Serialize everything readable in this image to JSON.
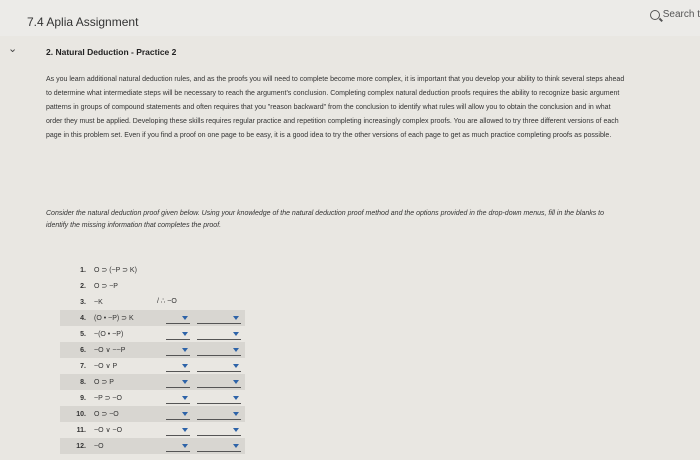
{
  "header": {
    "title": "7.4 Aplia Assignment",
    "search_label": "Search t"
  },
  "nav": {
    "back_symbol": "⌄"
  },
  "page": {
    "heading": "2. Natural Deduction - Practice 2",
    "intro": "As you learn additional natural deduction rules, and as the proofs you will need to complete become more complex, it is important that you develop your ability to think several steps ahead to determine what intermediate steps will be necessary to reach the argument's conclusion. Completing complex natural deduction proofs requires the ability to recognize basic argument patterns in groups of compound statements and often requires that you \"reason backward\" from the conclusion to identify what rules will allow you to obtain the conclusion and in what order they must be applied. Developing these skills requires regular practice and repetition completing increasingly complex proofs. You are allowed to try three different versions of each page in this problem set. Even if you find a proof on one page to be easy, it is a good idea to try the other versions of each page to get as much practice completing proofs as possible.",
    "instructions": "Consider the natural deduction proof given below. Using your knowledge of the natural deduction proof method and the options provided in the drop-down menus, fill in the blanks to identify the missing information that completes the proof."
  },
  "proof": {
    "conclusion_marker": "/ ∴ ~O",
    "rows": [
      {
        "num": "1.",
        "formula": "O ⊃ (~P ⊃ K)"
      },
      {
        "num": "2.",
        "formula": "O ⊃ ~P"
      },
      {
        "num": "3.",
        "formula": "~K"
      },
      {
        "num": "4.",
        "formula": "(O • ~P) ⊃ K"
      },
      {
        "num": "5.",
        "formula": "~(O • ~P)"
      },
      {
        "num": "6.",
        "formula": "~O ∨ ~~P"
      },
      {
        "num": "7.",
        "formula": "~O ∨ P"
      },
      {
        "num": "8.",
        "formula": "O ⊃ P"
      },
      {
        "num": "9.",
        "formula": "~P ⊃ ~O"
      },
      {
        "num": "10.",
        "formula": "O ⊃ ~O"
      },
      {
        "num": "11.",
        "formula": "~O ∨ ~O"
      },
      {
        "num": "12.",
        "formula": "~O"
      }
    ]
  },
  "colors": {
    "dropdown_arrow": "#2d63a8",
    "shaded_row": "#d8d6d1"
  }
}
